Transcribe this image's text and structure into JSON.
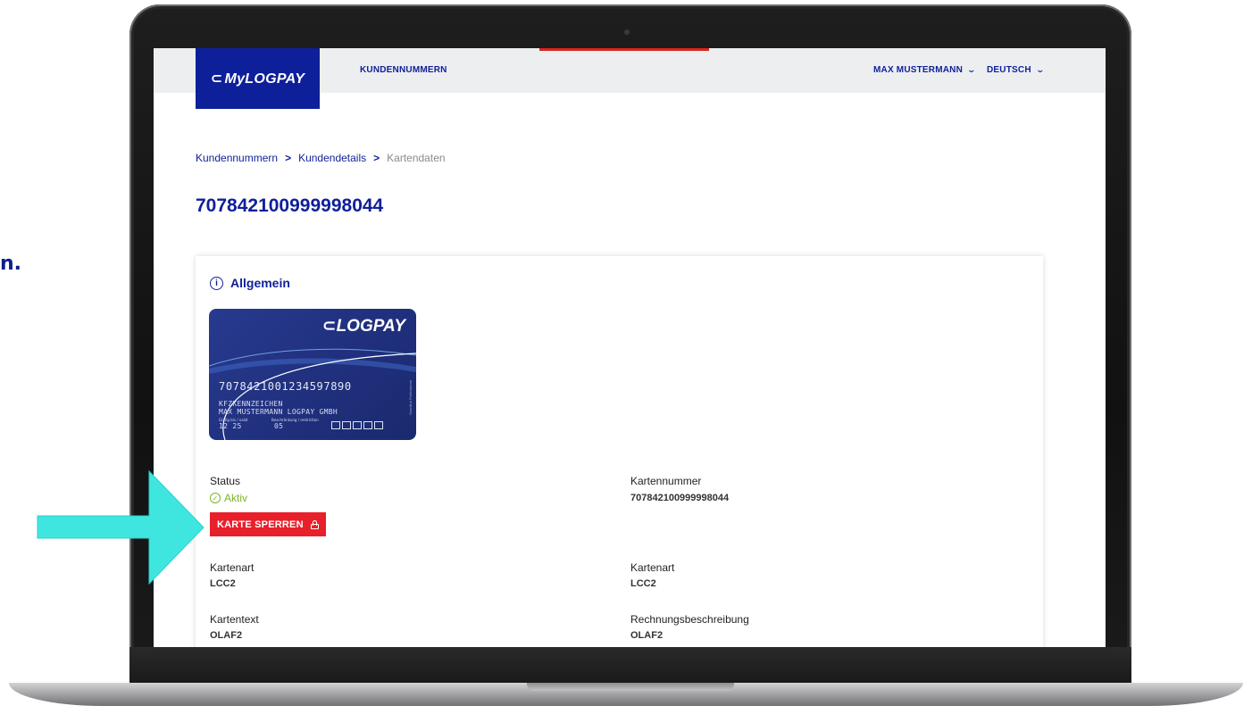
{
  "left_fragment": "n.",
  "app": {
    "logo_text": "MyLOGPAY",
    "nav_customers": "KUNDENNUMMERN",
    "user_menu": "MAX MUSTERMANN",
    "language_menu": "DEUTSCH"
  },
  "breadcrumb": {
    "items": [
      "Kundennummern",
      "Kundendetails",
      "Kartendaten"
    ],
    "separator": ">"
  },
  "page_title": "707842100999998044",
  "panel": {
    "heading": "Allgemein",
    "card": {
      "brand": "LOGPAY",
      "number": "7078421001234597890",
      "line1": "KFZKENNZEICHEN",
      "line2": "MAX MUSTERMANN LOGPAY GMBH",
      "valid_label": "Gültig bis / valid",
      "valid_value": "12 25",
      "restriction_label": "Beschränkung / restriction",
      "restriction_value": "05"
    },
    "fields": {
      "status_label": "Status",
      "status_value": "Aktiv",
      "block_button": "KARTE SPERREN",
      "card_number_label": "Kartennummer",
      "card_number_value": "707842100999998044",
      "card_type_label_left": "Kartenart",
      "card_type_value_left": "LCC2",
      "card_type_label_right": "Kartenart",
      "card_type_value_right": "LCC2",
      "card_text_label": "Kartentext",
      "card_text_value": "OLAF2",
      "invoice_desc_label": "Rechnungsbeschreibung",
      "invoice_desc_value": "OLAF2"
    }
  },
  "colors": {
    "brand_blue": "#0e1f9a",
    "status_green": "#7ab522",
    "danger_red": "#e8202a",
    "arrow_cyan": "#3fe6e0"
  }
}
